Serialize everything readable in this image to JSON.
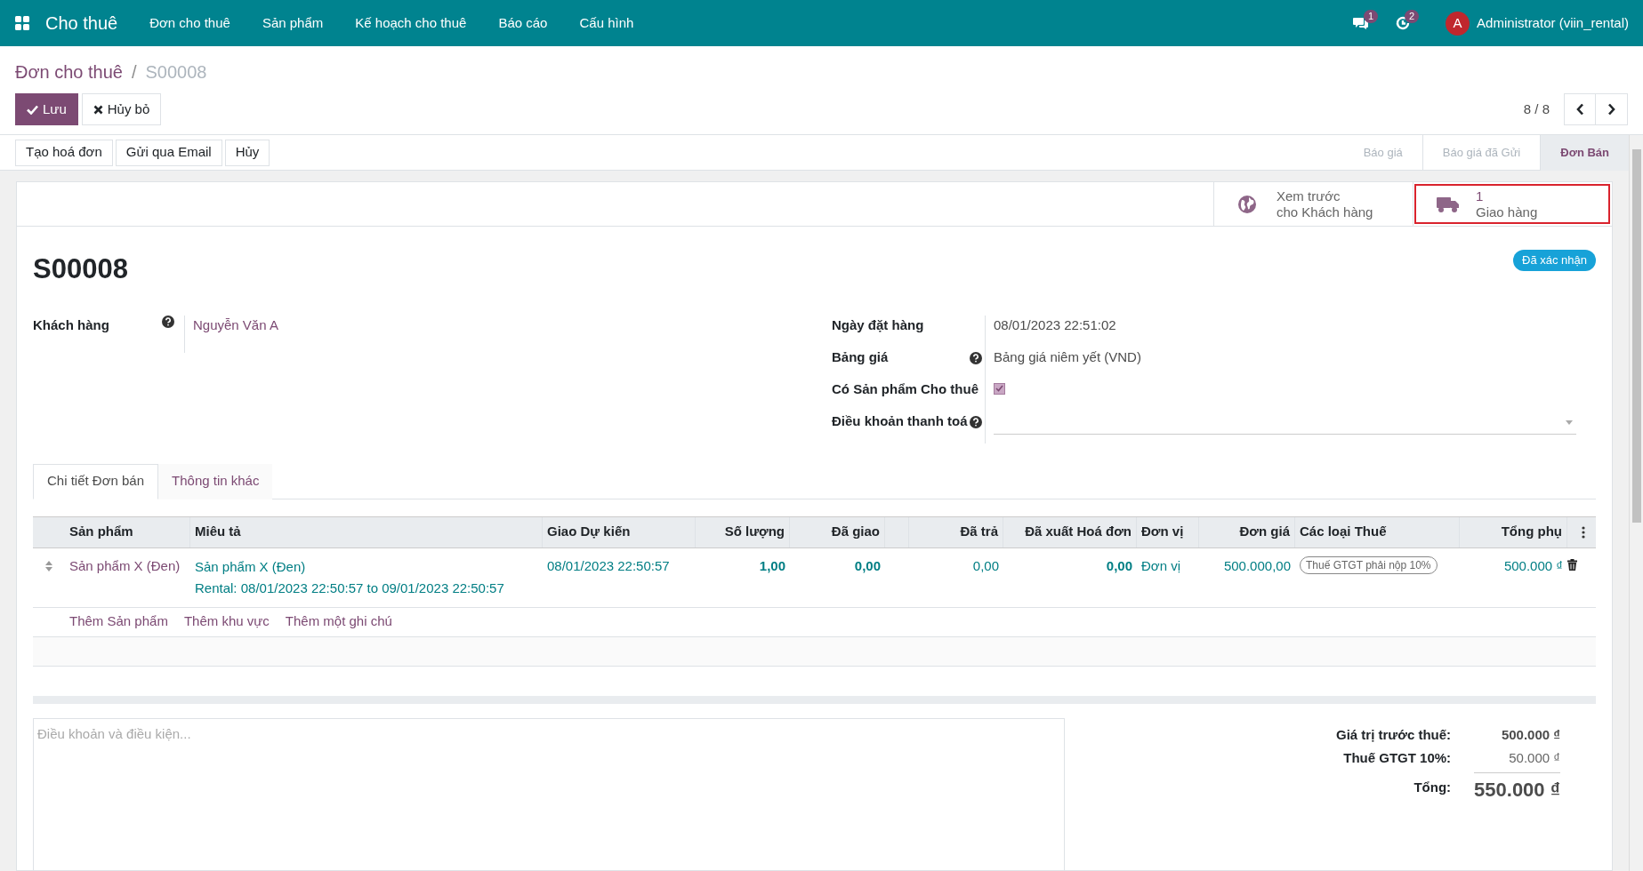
{
  "navbar": {
    "app": "Cho thuê",
    "menu": [
      "Đơn cho thuê",
      "Sản phẩm",
      "Kế hoạch cho thuê",
      "Báo cáo",
      "Cấu hình"
    ],
    "messages_count": "1",
    "activities_count": "2",
    "user_initial": "A",
    "user": "Administrator (viin_rental)"
  },
  "breadcrumb": {
    "parent": "Đơn cho thuê",
    "separator": "/",
    "current": "S00008"
  },
  "buttons": [
    {
      "kind": "primary",
      "label": "Lưu"
    },
    {
      "kind": "secondary",
      "label": "Hủy bỏ"
    }
  ],
  "pager": {
    "text": "8 / 8"
  },
  "actions": [
    "Tạo hoá đơn",
    "Gửi qua Email",
    "Hủy"
  ],
  "stages": [
    {
      "label": "Báo giá",
      "selected": false
    },
    {
      "label": "Báo giá đã Gửi",
      "selected": false
    },
    {
      "label": "Đơn Bán",
      "selected": true
    }
  ],
  "smart_buttons": [
    {
      "kind": "globe",
      "line1": "Xem trước",
      "line2": "cho Khách hàng",
      "highlighted": false
    },
    {
      "kind": "truck",
      "line1": "1",
      "line2": "Giao hàng",
      "highlighted": true
    }
  ],
  "title": "S00008",
  "status_badge": "Đã xác nhận",
  "left_fields": [
    {
      "label": "Khách hàng",
      "help": true,
      "value": "Nguyễn Văn A"
    }
  ],
  "right_fields": [
    {
      "kind": "text",
      "label": "Ngày đặt hàng",
      "help": false,
      "value": "08/01/2023 22:51:02"
    },
    {
      "kind": "text",
      "label": "Bảng giá",
      "help": true,
      "value": "Bảng giá niêm yết (VND)"
    },
    {
      "kind": "checkbox",
      "label": "Có Sản phẩm Cho thuê",
      "help": false,
      "checked": true
    },
    {
      "kind": "select",
      "label": "Điều khoản thanh toá",
      "help": true
    }
  ],
  "tabs": [
    {
      "label": "Chi tiết Đơn bán",
      "selected": true
    },
    {
      "label": "Thông tin khác",
      "selected": false
    }
  ],
  "table": {
    "columns": [
      "Sản phẩm",
      "Miêu tả",
      "Giao Dự kiến",
      "Số lượng",
      "Đã giao",
      "",
      "Đã trả",
      "Đã xuất Hoá đơn",
      "Đơn vị",
      "Đơn giá",
      "Các loại Thuế",
      "Tổng phụ"
    ],
    "rows": [
      {
        "product": "Sản phẩm X (Đen)",
        "description": [
          "Sản phẩm X (Đen)",
          "Rental: 08/01/2023 22:50:57 to 09/01/2023 22:50:57"
        ],
        "date": "08/01/2023 22:50:57",
        "qty": "1,00",
        "delivered": "0,00",
        "returned": "0,00",
        "invoiced": "0,00",
        "uom": "Đơn vị",
        "price": "500.000,00",
        "tax": "Thuế GTGT phải nộp 10%",
        "subtotal": "500.000 ₫"
      }
    ],
    "add_links": [
      "Thêm Sản phẩm",
      "Thêm khu vực",
      "Thêm một ghi chú"
    ]
  },
  "notes": {
    "placeholder": "Điều khoản và điều kiện..."
  },
  "totals": [
    {
      "kind": "untaxed",
      "label": "Giá trị trước thuế:",
      "value": "500.000 ₫"
    },
    {
      "kind": "tax",
      "label": "Thuế GTGT 10%:",
      "value": "50.000 ₫"
    },
    {
      "kind": "total",
      "label": "Tổng:",
      "value": "550.000 ₫"
    }
  ]
}
